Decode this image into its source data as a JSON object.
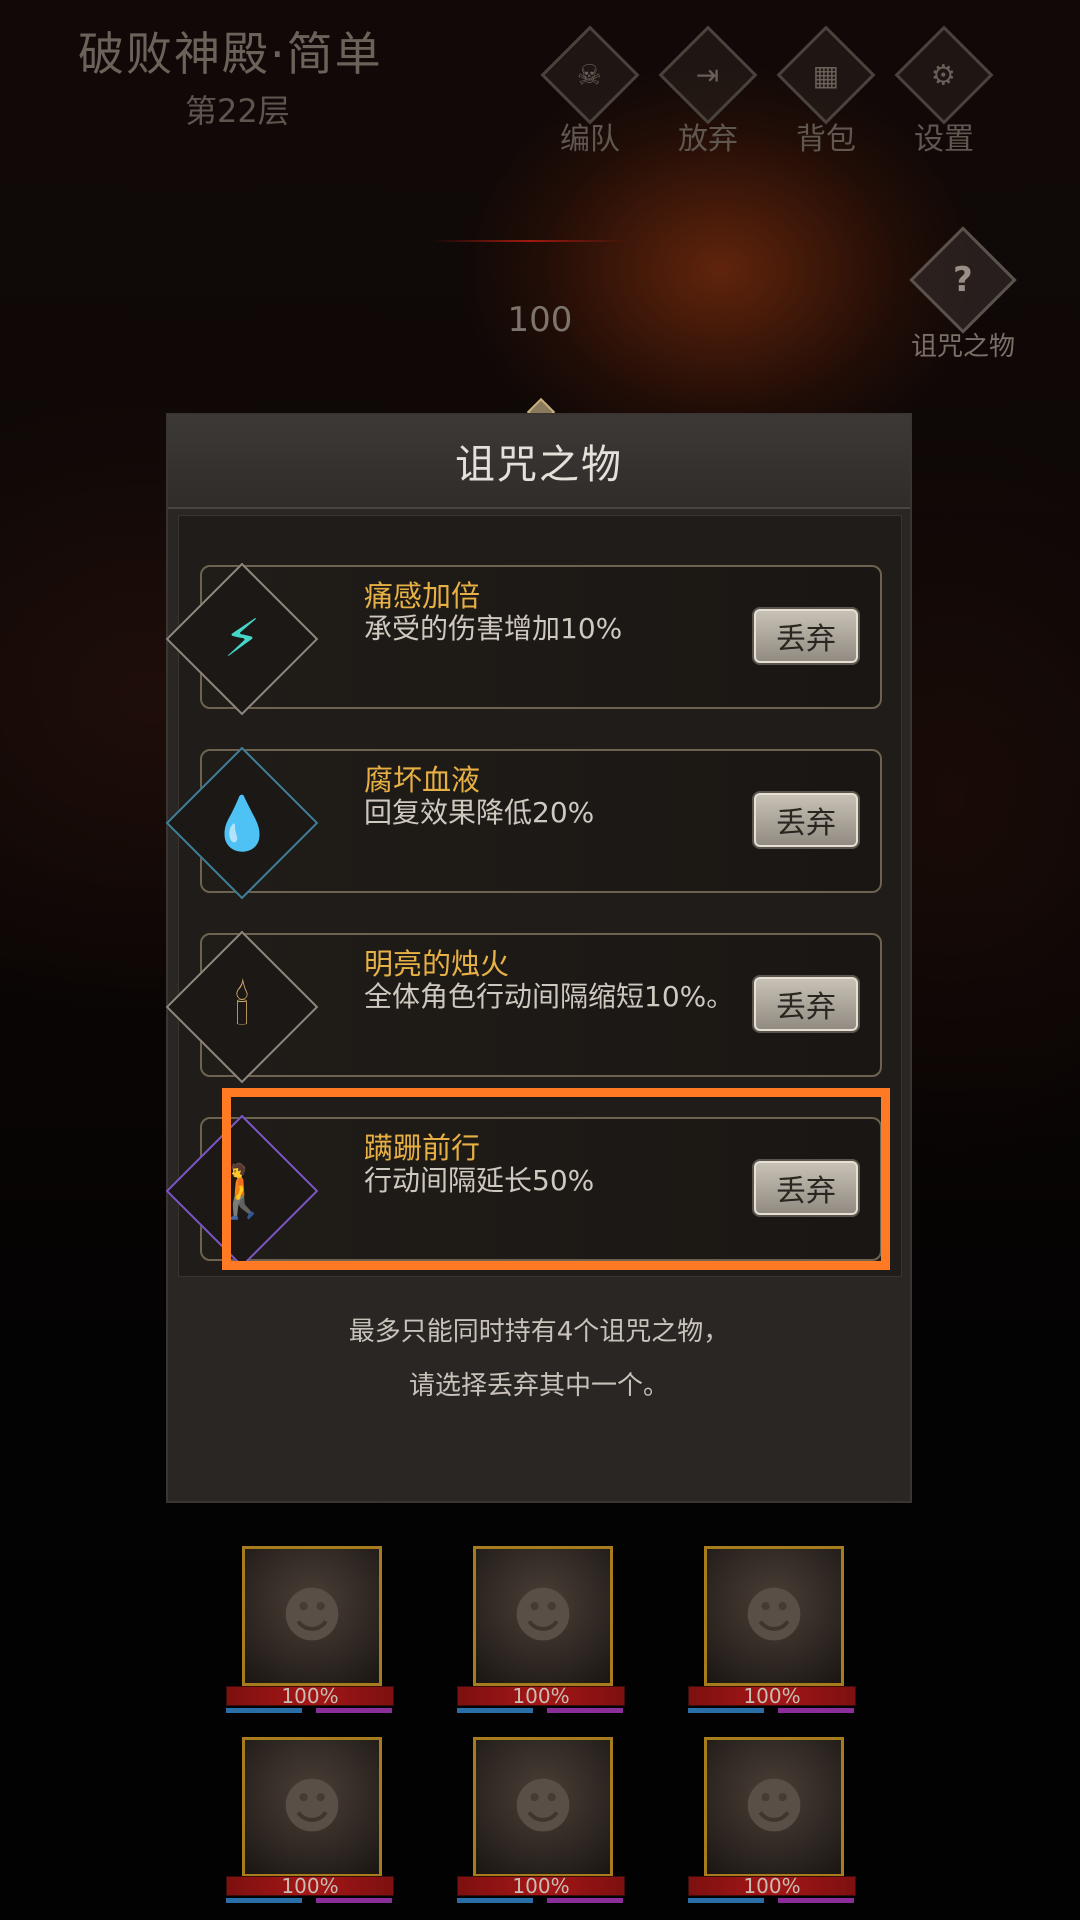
{
  "header": {
    "title": "破败神殿·简单",
    "floor": "第22层",
    "buttons": [
      {
        "label": "编队",
        "icon": "team-icon"
      },
      {
        "label": "放弃",
        "icon": "exit-icon"
      },
      {
        "label": "背包",
        "icon": "bag-icon"
      },
      {
        "label": "设置",
        "icon": "gear-icon"
      }
    ],
    "curse_button": {
      "label": "诅咒之物",
      "icon": "question-icon"
    },
    "counter": "100"
  },
  "modal": {
    "title": "诅咒之物",
    "items": [
      {
        "name": "痛感加倍",
        "desc": "承受的伤害增加10%",
        "button": "丢弃",
        "icon": "lightning-figure-icon"
      },
      {
        "name": "腐坏血液",
        "desc": "回复效果降低20%",
        "button": "丢弃",
        "icon": "blood-drop-icon"
      },
      {
        "name": "明亮的烛火",
        "desc": "全体角色行动间隔缩短10%。",
        "button": "丢弃",
        "icon": "candelabra-icon"
      },
      {
        "name": "蹒跚前行",
        "desc": "行动间隔延长50%",
        "button": "丢弃",
        "icon": "stumbling-figure-icon"
      }
    ],
    "footer_line1": "最多只能同时持有4个诅咒之物，",
    "footer_line2": "请选择丢弃其中一个。"
  },
  "heroes": [
    {
      "hp": "100%"
    },
    {
      "hp": "100%"
    },
    {
      "hp": "100%"
    },
    {
      "hp": "100%"
    },
    {
      "hp": "100%"
    },
    {
      "hp": "100%"
    }
  ]
}
